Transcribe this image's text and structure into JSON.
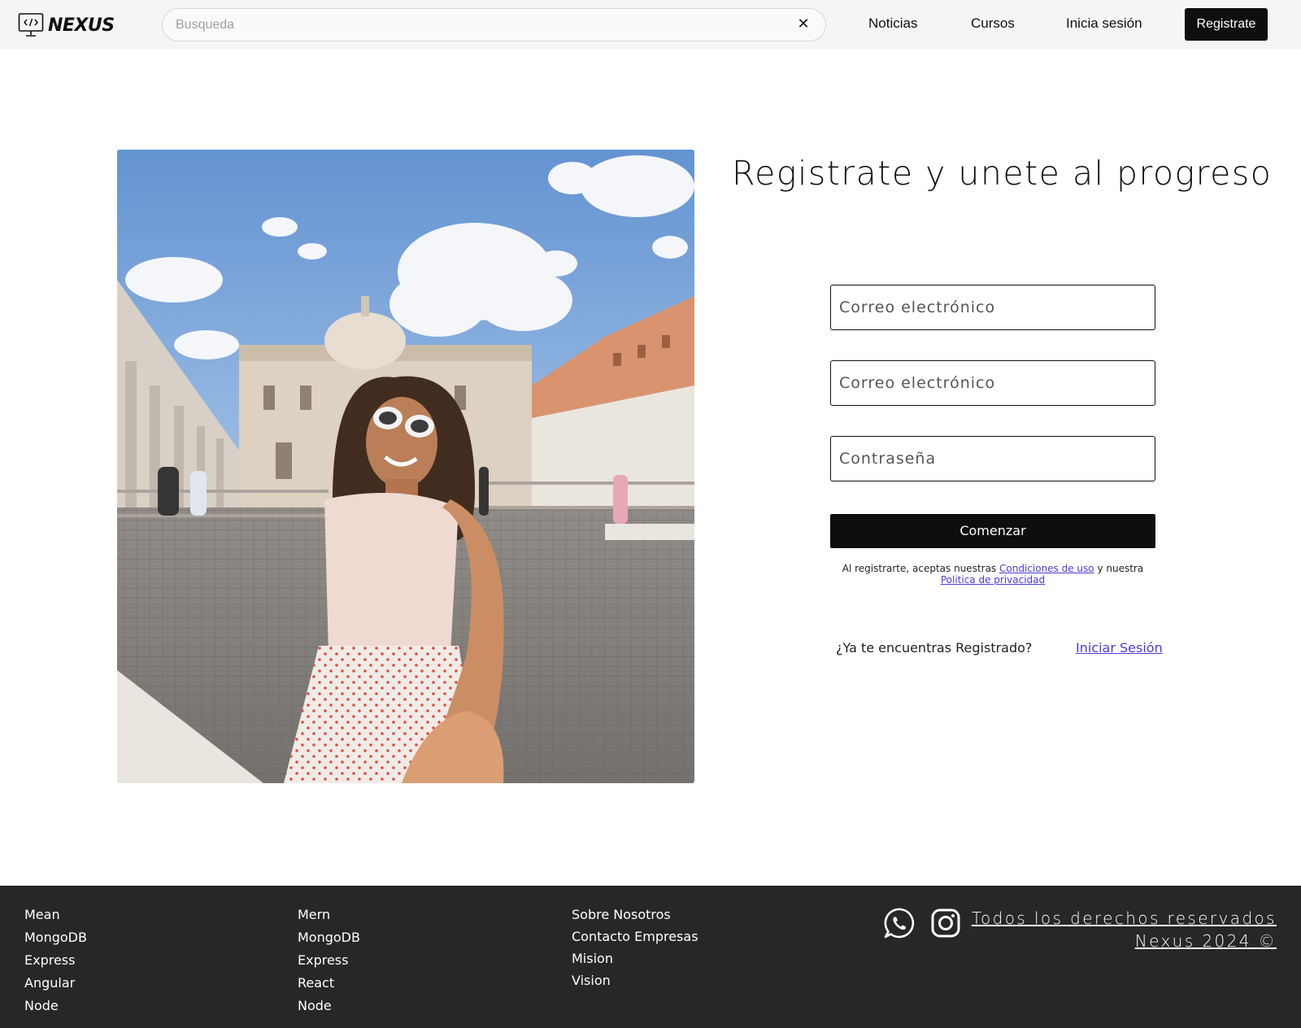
{
  "header": {
    "brand": "NEXUS",
    "search": {
      "placeholder": "Busqueda",
      "value": "",
      "clear_glyph": "✕"
    },
    "nav": {
      "noticias": "Noticias",
      "cursos": "Cursos",
      "login": "Inicia sesión",
      "register": "Registrate"
    }
  },
  "hero_image": {
    "icon": "photo-woman-leading-by-hand-st-peters-square"
  },
  "form": {
    "title": "Registrate y unete al progreso",
    "fields": [
      {
        "placeholder": "Correo electrónico"
      },
      {
        "placeholder": "Correo electrónico"
      },
      {
        "placeholder": "Contraseña"
      }
    ],
    "submit": "Comenzar",
    "terms": {
      "prefix": "Al registrarte, aceptas nuestras",
      "conditions_link": "Condiciones de uso",
      "middle": "y nuestra",
      "privacy_link": "Politica de privacidad"
    },
    "already_registered": "¿Ya te encuentras Registrado?",
    "login_link": "Iniciar Sesión"
  },
  "footer": {
    "col1": [
      "Mean",
      "MongoDB",
      "Express",
      "Angular",
      "Node"
    ],
    "col2": [
      "Mern",
      "MongoDB",
      "Express",
      "React",
      "Node"
    ],
    "col3": [
      "Sobre Nosotros",
      "Contacto Empresas",
      "Mision",
      "Vision"
    ],
    "social": [
      "whatsapp-icon",
      "instagram-icon"
    ],
    "rights_line1": "Todos los derechos reservados",
    "rights_line2": "Nexus 2024 ©"
  },
  "colors": {
    "header_bg": "#f5f5f5",
    "button_bg": "#0e0e0e",
    "link": "#4b3bdc",
    "footer_bg": "#272727"
  }
}
